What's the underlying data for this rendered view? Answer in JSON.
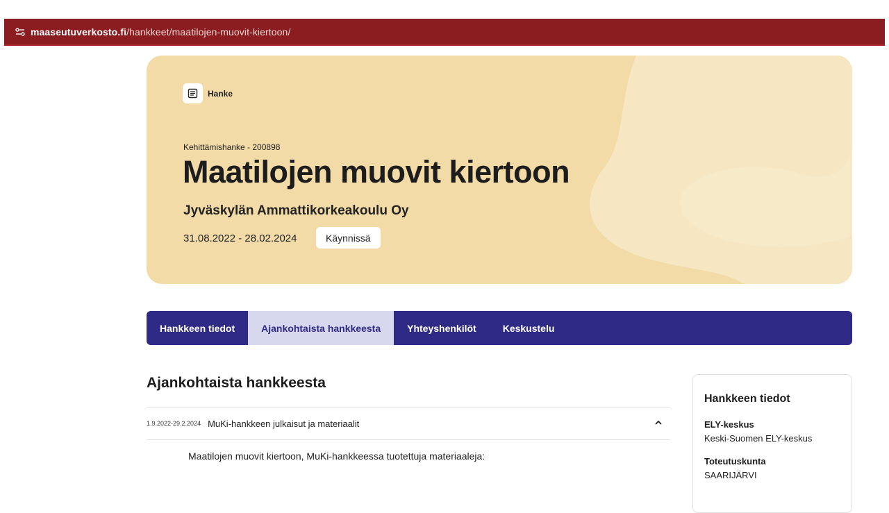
{
  "browser": {
    "url_domain": "maaseutuverkosto.fi",
    "url_path": "/hankkeet/maatilojen-muovit-kiertoon/"
  },
  "hero": {
    "badge_label": "Hanke",
    "subtitle": "Kehittämishanke - 200898",
    "title": "Maatilojen muovit kiertoon",
    "organization": "Jyväskylän Ammattikorkeakoulu Oy",
    "dates": "31.08.2022 - 28.02.2024",
    "status": "Käynnissä",
    "background_color": "#f2dba6"
  },
  "tabs": [
    {
      "label": "Hankkeen tiedot",
      "active": false
    },
    {
      "label": "Ajankohtaista hankkeesta",
      "active": true
    },
    {
      "label": "Yhteyshenkilöt",
      "active": false
    },
    {
      "label": "Keskustelu",
      "active": false
    }
  ],
  "news": {
    "section_title": "Ajankohtaista hankkeesta",
    "items": [
      {
        "date": "1.9.2022-29.2.2024",
        "title": "MuKi-hankkeen julkaisut ja materiaalit",
        "expanded": true,
        "body": "Maatilojen muovit kiertoon, MuKi-hankkeessa tuotettuja materiaaleja:"
      }
    ]
  },
  "sidebar": {
    "title": "Hankkeen tiedot",
    "fields": [
      {
        "label": "ELY-keskus",
        "value": "Keski-Suomen ELY-keskus"
      },
      {
        "label": "Toteutuskunta",
        "value": "SAARIJÄRVI"
      }
    ]
  },
  "colors": {
    "brand_navy": "#2e2a86",
    "tab_active_bg": "#d7d8ee",
    "browser_bar": "#8b1c1f"
  }
}
